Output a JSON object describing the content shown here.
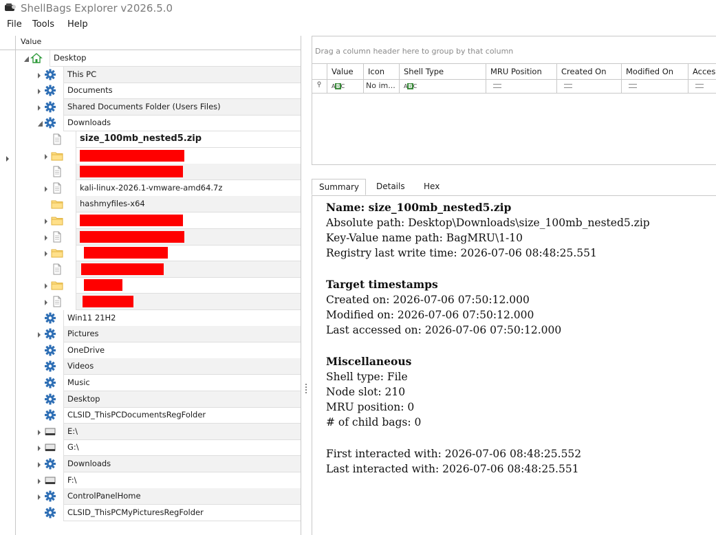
{
  "app": {
    "title": "ShellBags Explorer v2026.5.0"
  },
  "menu": [
    "File",
    "Tools",
    "Help"
  ],
  "tree": {
    "column_header": "Value",
    "rows": [
      {
        "label": "Desktop",
        "icon": "home-icon",
        "expander": "open",
        "indent": 0
      },
      {
        "label": "This PC",
        "icon": "gear-icon",
        "expander": "closed",
        "indent": 1
      },
      {
        "label": "Documents",
        "icon": "gear-icon",
        "expander": "closed",
        "indent": 1
      },
      {
        "label": "Shared Documents Folder (Users Files)",
        "icon": "gear-icon",
        "expander": "closed",
        "indent": 1
      },
      {
        "label": "Downloads",
        "icon": "gear-icon",
        "expander": "open",
        "indent": 1
      },
      {
        "label": "size_100mb_nested5.zip",
        "icon": "file-icon",
        "expander": "none",
        "indent": 2,
        "selected": true
      },
      {
        "label": "",
        "icon": "folder-icon",
        "expander": "closed",
        "indent": 2,
        "redacted": 152
      },
      {
        "label": "",
        "icon": "file-icon",
        "expander": "none",
        "indent": 2,
        "redacted": 150
      },
      {
        "label": "kali-linux-2026.1-vmware-amd64.7z",
        "icon": "file-icon",
        "expander": "closed",
        "indent": 2
      },
      {
        "label": "hashmyfiles-x64",
        "icon": "folder-icon",
        "expander": "none",
        "indent": 2
      },
      {
        "label": "",
        "icon": "folder-icon",
        "expander": "closed",
        "indent": 2,
        "redacted": 150
      },
      {
        "label": "",
        "icon": "file-icon",
        "expander": "closed",
        "indent": 2,
        "redacted": 152
      },
      {
        "label": "",
        "icon": "folder-icon",
        "expander": "closed",
        "indent": 2,
        "redacted": 122,
        "offset": 6
      },
      {
        "label": "",
        "icon": "file-icon",
        "expander": "none",
        "indent": 2,
        "redacted": 120,
        "offset": 2
      },
      {
        "label": "",
        "icon": "folder-icon",
        "expander": "closed",
        "indent": 2,
        "redacted": 56,
        "offset": 6
      },
      {
        "label": "",
        "icon": "file-icon",
        "expander": "closed",
        "indent": 2,
        "redacted": 74,
        "offset": 4
      },
      {
        "label": "Win11 21H2",
        "icon": "gear-icon",
        "expander": "none",
        "indent": 1
      },
      {
        "label": "Pictures",
        "icon": "gear-icon",
        "expander": "closed",
        "indent": 1
      },
      {
        "label": "OneDrive",
        "icon": "gear-icon",
        "expander": "none",
        "indent": 1
      },
      {
        "label": "Videos",
        "icon": "gear-icon",
        "expander": "none",
        "indent": 1
      },
      {
        "label": "Music",
        "icon": "gear-icon",
        "expander": "none",
        "indent": 1
      },
      {
        "label": "Desktop",
        "icon": "gear-icon",
        "expander": "none",
        "indent": 1
      },
      {
        "label": "CLSID_ThisPCDocumentsRegFolder",
        "icon": "gear-icon",
        "expander": "none",
        "indent": 1
      },
      {
        "label": "E:\\",
        "icon": "drive-icon",
        "expander": "closed",
        "indent": 1
      },
      {
        "label": "G:\\",
        "icon": "drive-icon",
        "expander": "closed",
        "indent": 1
      },
      {
        "label": "Downloads",
        "icon": "gear-icon",
        "expander": "closed",
        "indent": 1
      },
      {
        "label": "F:\\",
        "icon": "drive-icon",
        "expander": "closed",
        "indent": 1
      },
      {
        "label": "ControlPanelHome",
        "icon": "gear-icon",
        "expander": "closed",
        "indent": 1
      },
      {
        "label": "CLSID_ThisPCMyPicturesRegFolder",
        "icon": "gear-icon",
        "expander": "none",
        "indent": 1
      }
    ]
  },
  "grid": {
    "group_hint": "Drag a column header here to group by that column",
    "columns": [
      "Value",
      "Icon",
      "Shell Type",
      "MRU Position",
      "Created On",
      "Modified On",
      "Acces"
    ],
    "filter": {
      "icon": "No im..."
    }
  },
  "tabs": [
    "Summary",
    "Details",
    "Hex"
  ],
  "summary": {
    "name": "Name: size_100mb_nested5.zip",
    "absolute_path": "Absolute path: Desktop\\Downloads\\size_100mb_nested5.zip",
    "key_value_path": "Key-Value name path: BagMRU\\1-10",
    "registry_write": "Registry last write time: 2026-07-06 08:48:25.551",
    "target_heading": "Target timestamps",
    "created_on": "Created on: 2026-07-06 07:50:12.000",
    "modified_on": "Modified on: 2026-07-06 07:50:12.000",
    "last_accessed": "Last accessed on: 2026-07-06 07:50:12.000",
    "misc_heading": "Miscellaneous",
    "shell_type": "Shell type: File",
    "node_slot": "Node slot: 210",
    "mru_position": "MRU position: 0",
    "child_bags": "# of child bags: 0",
    "first_interacted": "First interacted with: 2026-07-06 08:48:25.552",
    "last_interacted": "Last interacted with: 2026-07-06 08:48:25.551"
  }
}
